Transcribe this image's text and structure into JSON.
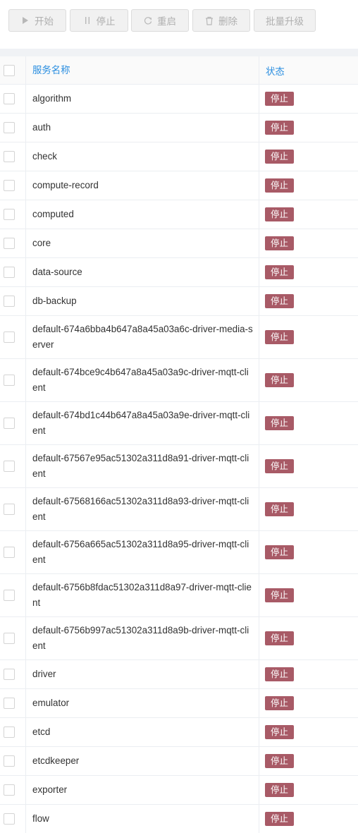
{
  "toolbar": {
    "start_label": "开始",
    "pause_label": "停止",
    "restart_label": "重启",
    "delete_label": "删除",
    "upgrade_label": "批量升级"
  },
  "table": {
    "headers": {
      "name": "服务名称",
      "status": "状态"
    },
    "rows": [
      {
        "name": "algorithm",
        "status": "停止"
      },
      {
        "name": "auth",
        "status": "停止"
      },
      {
        "name": "check",
        "status": "停止"
      },
      {
        "name": "compute-record",
        "status": "停止"
      },
      {
        "name": "computed",
        "status": "停止"
      },
      {
        "name": "core",
        "status": "停止"
      },
      {
        "name": "data-source",
        "status": "停止"
      },
      {
        "name": "db-backup",
        "status": "停止"
      },
      {
        "name": "default-674a6bba4b647a8a45a03a6c-driver-media-server",
        "status": "停止"
      },
      {
        "name": "default-674bce9c4b647a8a45a03a9c-driver-mqtt-client",
        "status": "停止"
      },
      {
        "name": "default-674bd1c44b647a8a45a03a9e-driver-mqtt-client",
        "status": "停止"
      },
      {
        "name": "default-67567e95ac51302a311d8a91-driver-mqtt-client",
        "status": "停止"
      },
      {
        "name": "default-67568166ac51302a311d8a93-driver-mqtt-client",
        "status": "停止"
      },
      {
        "name": "default-6756a665ac51302a311d8a95-driver-mqtt-client",
        "status": "停止"
      },
      {
        "name": "default-6756b8fdac51302a311d8a97-driver-mqtt-client",
        "status": "停止"
      },
      {
        "name": "default-6756b997ac51302a311d8a9b-driver-mqtt-client",
        "status": "停止"
      },
      {
        "name": "driver",
        "status": "停止"
      },
      {
        "name": "emulator",
        "status": "停止"
      },
      {
        "name": "etcd",
        "status": "停止"
      },
      {
        "name": "etcdkeeper",
        "status": "停止"
      },
      {
        "name": "exporter",
        "status": "停止"
      },
      {
        "name": "flow",
        "status": "停止"
      }
    ]
  },
  "colors": {
    "header_text": "#2a8ee0",
    "stopped_badge": "#a85a66",
    "disabled_button_bg": "#f1f1f1",
    "disabled_button_text": "#b0b0b0"
  }
}
